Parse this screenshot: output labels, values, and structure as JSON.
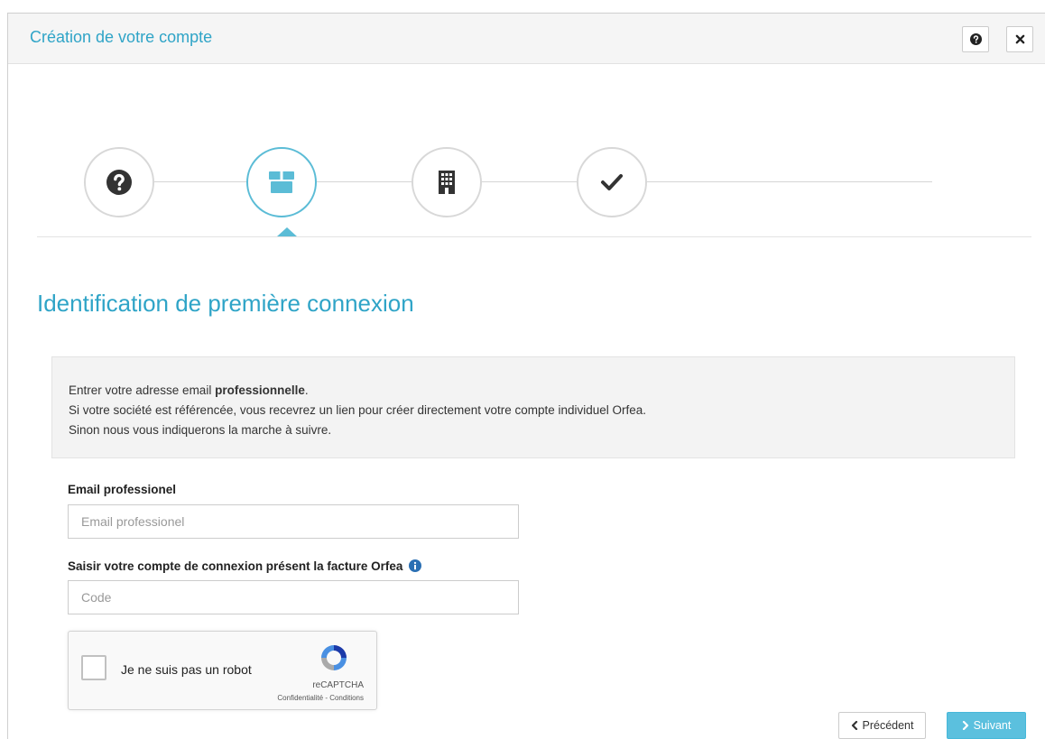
{
  "header": {
    "title": "Création de votre compte"
  },
  "stepper": {
    "steps": [
      {
        "icon": "question-circle-icon",
        "active": false
      },
      {
        "icon": "box-icon",
        "active": true
      },
      {
        "icon": "building-icon",
        "active": false
      },
      {
        "icon": "check-icon",
        "active": false
      }
    ]
  },
  "section": {
    "title": "Identification de première connexion"
  },
  "info": {
    "line1_prefix": "Entrer votre adresse email ",
    "line1_bold": "professionnelle",
    "line1_suffix": ".",
    "line2": "Si votre société est référencée, vous recevrez un lien pour créer directement votre compte individuel Orfea.",
    "line3": "Sinon nous vous indiquerons la marche à suivre."
  },
  "form": {
    "email_label": "Email professionel",
    "email_placeholder": "Email professionel",
    "email_value": "",
    "code_label": "Saisir votre compte de connexion présent la facture Orfea",
    "code_placeholder": "Code",
    "code_value": ""
  },
  "recaptcha": {
    "label": "Je ne suis pas un robot",
    "brand": "reCAPTCHA",
    "links": "Confidentialité - Conditions"
  },
  "buttons": {
    "prev_label": "Précédent",
    "next_label": "Suivant"
  },
  "colors": {
    "accent": "#2fa4c7",
    "step_active": "#5bbcd6",
    "next_button": "#5bc0de"
  }
}
